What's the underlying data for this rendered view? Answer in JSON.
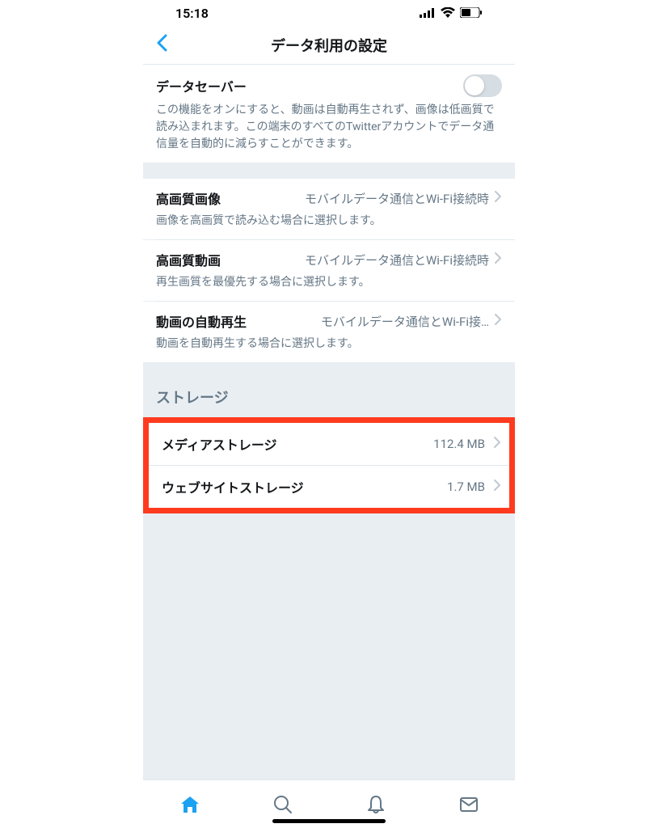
{
  "status": {
    "time": "15:18"
  },
  "header": {
    "title": "データ利用の設定"
  },
  "dataSaver": {
    "title": "データセーバー",
    "description": "この機能をオンにすると、動画は自動再生されず、画像は低画質で読み込まれます。この端末のすべてのTwitterアカウントでデータ通信量を自動的に減らすことができます。"
  },
  "quality": {
    "imageTitle": "高画質画像",
    "imageValue": "モバイルデータ通信とWi-Fi接続時",
    "imageDesc": "画像を高画質で読み込む場合に選択します。",
    "videoTitle": "高画質動画",
    "videoValue": "モバイルデータ通信とWi-Fi接続時",
    "videoDesc": "再生画質を最優先する場合に選択します。",
    "autoplayTitle": "動画の自動再生",
    "autoplayValue": "モバイルデータ通信とWi-Fi接…",
    "autoplayDesc": "動画を自動再生する場合に選択します。"
  },
  "storage": {
    "header": "ストレージ",
    "mediaTitle": "メディアストレージ",
    "mediaValue": "112.4 MB",
    "webTitle": "ウェブサイトストレージ",
    "webValue": "1.7 MB"
  }
}
